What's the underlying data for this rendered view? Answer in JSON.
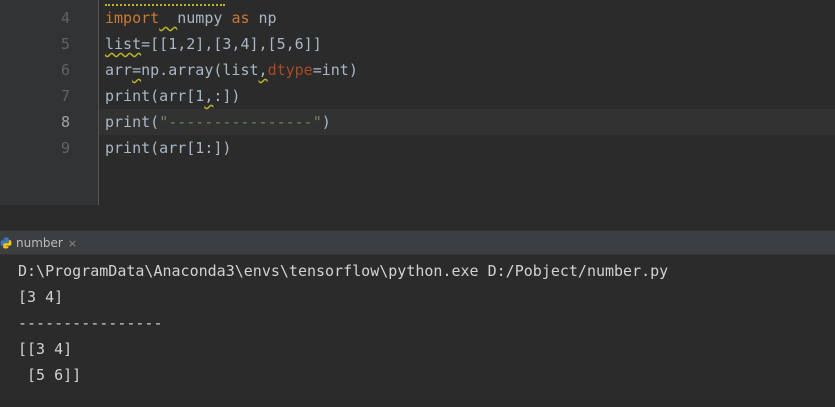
{
  "editor": {
    "line_numbers": [
      "4",
      "5",
      "6",
      "7",
      "8",
      "9"
    ],
    "lines": [
      {
        "segments": [
          {
            "text": "import",
            "style": "kw"
          },
          {
            "text": "  ",
            "style": "sq"
          },
          {
            "text": "numpy ",
            "style": ""
          },
          {
            "text": "as",
            "style": "kw"
          },
          {
            "text": " np",
            "style": ""
          }
        ]
      },
      {
        "segments": [
          {
            "text": "list",
            "style": "sq"
          },
          {
            "text": "=[[1,2],[3,4],[5,6]]",
            "style": ""
          }
        ]
      },
      {
        "segments": [
          {
            "text": "arr",
            "style": ""
          },
          {
            "text": "=",
            "style": "sq"
          },
          {
            "text": "np.array(list",
            "style": ""
          },
          {
            "text": ",",
            "style": "sq"
          },
          {
            "text": "dtype",
            "style": "param"
          },
          {
            "text": "=int)",
            "style": ""
          }
        ]
      },
      {
        "segments": [
          {
            "text": "print(arr[1",
            "style": ""
          },
          {
            "text": ",",
            "style": "sq"
          },
          {
            "text": ":])",
            "style": ""
          }
        ]
      },
      {
        "segments": [
          {
            "text": "print(",
            "style": ""
          },
          {
            "text": "\"----------------\"",
            "style": "str"
          },
          {
            "text": ")",
            "style": ""
          }
        ]
      },
      {
        "segments": [
          {
            "text": "print(arr[1:])",
            "style": ""
          }
        ]
      }
    ]
  },
  "run_panel": {
    "tab_label": "number",
    "close_glyph": "×",
    "icon": "python-icon"
  },
  "console": {
    "lines": [
      "D:\\ProgramData\\Anaconda3\\envs\\tensorflow\\python.exe D:/Pobject/number.py",
      "[3 4]",
      "----------------",
      "[[3 4]",
      " [5 6]]"
    ]
  }
}
